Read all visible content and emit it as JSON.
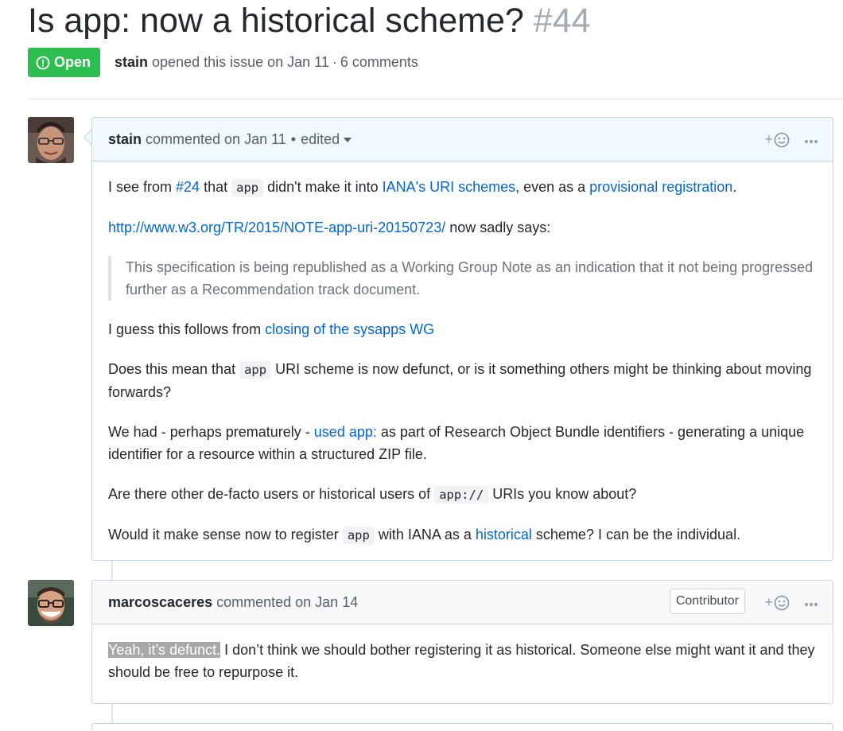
{
  "issue": {
    "title": "Is app: now a historical scheme?",
    "number": "#44",
    "state": "Open",
    "author": "stain",
    "opened_text": "opened this issue on Jan 11",
    "separator": "·",
    "comment_count": "6 comments"
  },
  "comments": [
    {
      "author": "stain",
      "action": "commented on Jan 11",
      "dot": "•",
      "edited": "edited",
      "react_plus": "+",
      "body": {
        "p1": {
          "t1": "I see from ",
          "link1": "#24",
          "t2": " that ",
          "code1": "app",
          "t3": " didn't make it into ",
          "link2": "IANA's URI schemes",
          "t4": ", even as a ",
          "link3": "provisional registration",
          "t5": "."
        },
        "p2": {
          "link": "http://www.w3.org/TR/2015/NOTE-app-uri-20150723/",
          "t1": " now sadly says:"
        },
        "quote": "This specification is being republished as a Working Group Note as an indication that it not being progressed further as a Recommendation track document.",
        "p3": {
          "t1": "I guess this follows from ",
          "link": "closing of the sysapps WG"
        },
        "p4": {
          "t1": "Does this mean that ",
          "code": "app",
          "t2": " URI scheme is now defunct, or is it something others might be thinking about moving forwards?"
        },
        "p5": {
          "t1": "We had - perhaps prematurely - ",
          "link": "used app:",
          "t2": " as part of Research Object Bundle identifiers - generating a unique identifier for a resource within a structured ZIP file."
        },
        "p6": {
          "t1": "Are there other de-facto users or historical users of ",
          "code": "app://",
          "t2": " URIs you know about?"
        },
        "p7": {
          "t1": "Would it make sense now to register ",
          "code": "app",
          "t2": " with IANA as a ",
          "link": "historical",
          "t3": " scheme? I can be the individual."
        }
      }
    },
    {
      "author": "marcoscaceres",
      "action": "commented on Jan 14",
      "role": "Contributor",
      "react_plus": "+",
      "body": {
        "highlight": "Yeah, it’s defunct.",
        "t1": " I don’t think we should bother registering it as historical. Someone else might want it and they should be free to repurpose it."
      }
    }
  ],
  "colors": {
    "open_badge": "#2cbe4e",
    "link": "#0366d6",
    "owner_header": "#f1f8ff",
    "header": "#f6f8fa"
  },
  "icons": [
    "issue-opened-icon",
    "smiley-icon",
    "kebab-horizontal-icon",
    "caret-down-icon"
  ]
}
